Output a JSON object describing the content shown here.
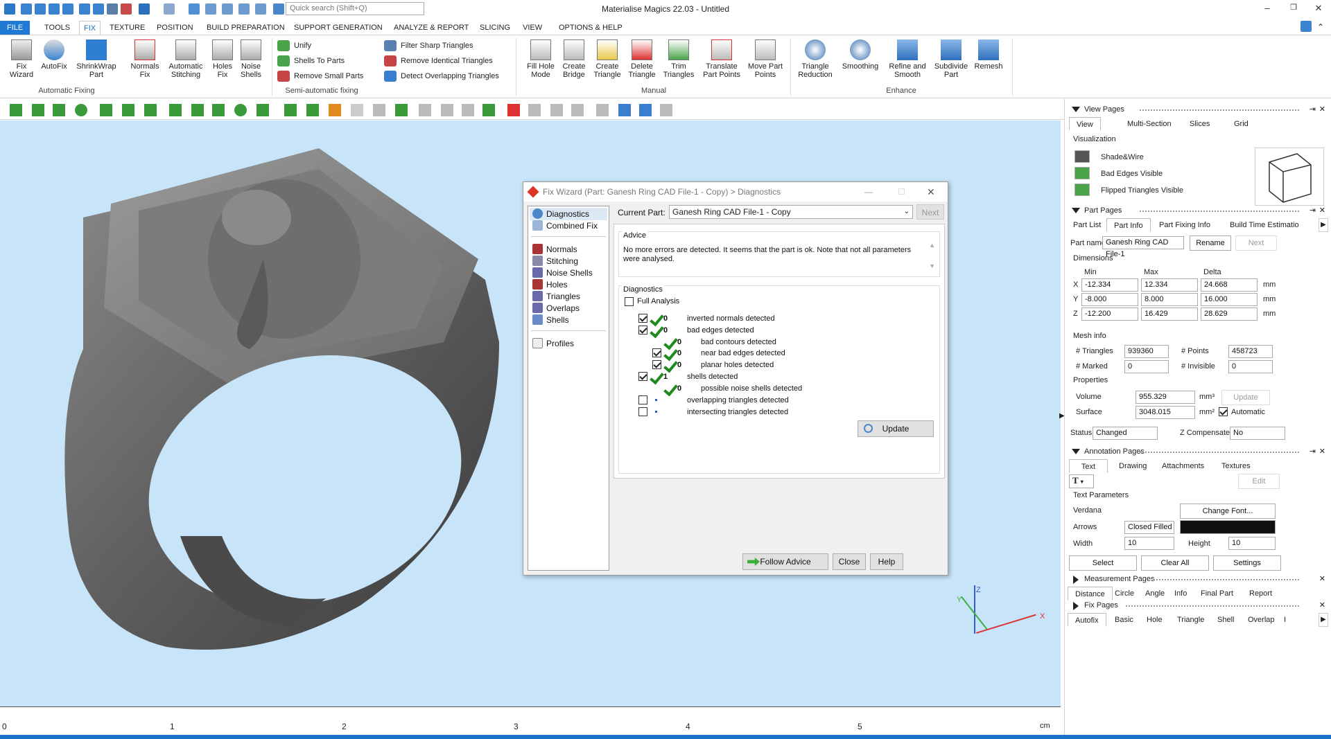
{
  "titlebar": {
    "search_placeholder": "Quick search (Shift+Q)",
    "title": "Materialise Magics 22.03 - Untitled",
    "minimize": "–",
    "restore": "❐",
    "close": "✕"
  },
  "menu": {
    "tabs": [
      "FILE",
      "TOOLS",
      "FIX",
      "TEXTURE",
      "POSITION",
      "BUILD PREPARATION",
      "SUPPORT GENERATION",
      "ANALYZE & REPORT",
      "SLICING",
      "VIEW",
      "OPTIONS & HELP"
    ],
    "active": "FIX"
  },
  "ribbon": {
    "auto": {
      "b1a": "Fix",
      "b1b": "Wizard",
      "b2": "AutoFix",
      "b3a": "ShrinkWrap",
      "b3b": "Part",
      "b4a": "Normals",
      "b4b": "Fix",
      "b5a": "Automatic",
      "b5b": "Stitching",
      "b6a": "Holes",
      "b6b": "Fix",
      "b7a": "Noise",
      "b7b": "Shells",
      "group": "Automatic Fixing"
    },
    "semi": {
      "s1": "Unify",
      "s2": "Shells To Parts",
      "s3": "Remove Small Parts",
      "s4": "Filter Sharp Triangles",
      "s5": "Remove Identical Triangles",
      "s6": "Detect Overlapping Triangles",
      "group": "Semi-automatic fixing"
    },
    "manual": {
      "m1a": "Fill Hole",
      "m1b": "Mode",
      "m2a": "Create",
      "m2b": "Bridge",
      "m3a": "Create",
      "m3b": "Triangle",
      "m4a": "Delete",
      "m4b": "Triangle",
      "m5a": "Trim",
      "m5b": "Triangles",
      "m6a": "Translate",
      "m6b": "Part Points",
      "m7a": "Move Part",
      "m7b": "Points",
      "group": "Manual"
    },
    "enhance": {
      "e1a": "Triangle",
      "e1b": "Reduction",
      "e2": "Smoothing",
      "e3a": "Refine and",
      "e3b": "Smooth",
      "e4a": "Subdivide",
      "e4b": "Part",
      "e5": "Remesh",
      "group": "Enhance"
    }
  },
  "ruler": {
    "labels": [
      "0",
      "1",
      "2",
      "3",
      "4",
      "5"
    ],
    "unit": "cm"
  },
  "axes": {
    "z": "Z",
    "x": "X",
    "y": "Y"
  },
  "dialog": {
    "title": "Fix Wizard (Part: Ganesh Ring CAD File-1 - Copy) > Diagnostics",
    "side": [
      "Diagnostics",
      "Combined Fix",
      "Normals",
      "Stitching",
      "Noise Shells",
      "Holes",
      "Triangles",
      "Overlaps",
      "Shells",
      "Profiles"
    ],
    "current_part_label": "Current Part:",
    "current_part": "Ganesh Ring CAD File-1 - Copy",
    "next": "Next",
    "advice_label": "Advice",
    "advice_text": "No more errors are detected. It seems that the part is ok. Note that not all parameters were analysed.",
    "diag_label": "Diagnostics",
    "full_analysis": "Full Analysis",
    "rows": [
      {
        "count": "0",
        "label": "inverted normals detected"
      },
      {
        "count": "0",
        "label": "bad edges detected"
      },
      {
        "count": "0",
        "label": "bad contours detected"
      },
      {
        "count": "0",
        "label": "near bad edges detected"
      },
      {
        "count": "0",
        "label": "planar holes detected"
      },
      {
        "count": "1",
        "label": "shells detected"
      },
      {
        "count": "0",
        "label": "possible noise shells detected"
      },
      {
        "count": "",
        "label": "overlapping triangles detected"
      },
      {
        "count": "",
        "label": "intersecting triangles detected"
      }
    ],
    "update": "Update",
    "follow": "Follow Advice",
    "close": "Close",
    "help": "Help"
  },
  "right": {
    "view_pages": "View Pages",
    "view_tabs": [
      "View",
      "Multi-Section",
      "Slices",
      "Grid"
    ],
    "visualization": "Visualization",
    "vis": [
      "Shade&Wire",
      "Bad Edges Visible",
      "Flipped Triangles Visible"
    ],
    "part_pages": "Part Pages",
    "part_tabs": [
      "Part List",
      "Part Info",
      "Part Fixing Info",
      "Build Time Estimatio"
    ],
    "part_name_label": "Part name",
    "part_name": "Ganesh Ring CAD File-1",
    "rename": "Rename",
    "next": "Next",
    "dimensions": "Dimensions",
    "min": "Min",
    "max": "Max",
    "delta": "Delta",
    "dims": [
      {
        "axis": "X",
        "min": "-12.334",
        "max": "12.334",
        "delta": "24.668",
        "unit": "mm"
      },
      {
        "axis": "Y",
        "min": "-8.000",
        "max": "8.000",
        "delta": "16.000",
        "unit": "mm"
      },
      {
        "axis": "Z",
        "min": "-12.200",
        "max": "16.429",
        "delta": "28.629",
        "unit": "mm"
      }
    ],
    "mesh_info": "Mesh info",
    "triangles_label": "# Triangles",
    "triangles": "939360",
    "points_label": "# Points",
    "points": "458723",
    "marked_label": "# Marked",
    "marked": "0",
    "invisible_label": "# Invisible",
    "invisible": "0",
    "properties": "Properties",
    "volume_label": "Volume",
    "volume": "955.329",
    "volume_unit": "mm³",
    "update": "Update",
    "surface_label": "Surface",
    "surface": "3048.015",
    "surface_unit": "mm²",
    "automatic": "Automatic",
    "status_label": "Status",
    "status": "Changed",
    "zcomp_label": "Z Compensated",
    "zcomp": "No",
    "annotation_pages": "Annotation Pages",
    "annot_tabs": [
      "Text",
      "Drawing",
      "Attachments",
      "Textures"
    ],
    "edit": "Edit",
    "text_params": "Text Parameters",
    "font_name": "Verdana",
    "change_font": "Change Font...",
    "arrows_label": "Arrows",
    "arrows": "Closed Filled",
    "width_label": "Width",
    "width": "10",
    "height_label": "Height",
    "height": "10",
    "select": "Select",
    "clear_all": "Clear All",
    "settings": "Settings",
    "measurement_pages": "Measurement Pages",
    "meas_tabs": [
      "Distance",
      "Circle",
      "Angle",
      "Info",
      "Final Part",
      "Report"
    ],
    "fix_pages": "Fix Pages",
    "fix_tabs": [
      "Autofix",
      "Basic",
      "Hole",
      "Triangle",
      "Shell",
      "Overlap",
      "I"
    ]
  }
}
